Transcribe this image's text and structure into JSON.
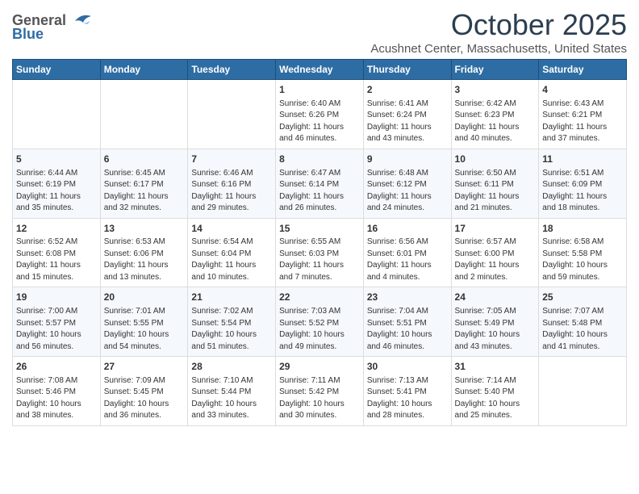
{
  "header": {
    "logo_general": "General",
    "logo_blue": "Blue",
    "month_title": "October 2025",
    "location": "Acushnet Center, Massachusetts, United States"
  },
  "weekdays": [
    "Sunday",
    "Monday",
    "Tuesday",
    "Wednesday",
    "Thursday",
    "Friday",
    "Saturday"
  ],
  "weeks": [
    [
      {
        "day": "",
        "info": ""
      },
      {
        "day": "",
        "info": ""
      },
      {
        "day": "",
        "info": ""
      },
      {
        "day": "1",
        "info": "Sunrise: 6:40 AM\nSunset: 6:26 PM\nDaylight: 11 hours\nand 46 minutes."
      },
      {
        "day": "2",
        "info": "Sunrise: 6:41 AM\nSunset: 6:24 PM\nDaylight: 11 hours\nand 43 minutes."
      },
      {
        "day": "3",
        "info": "Sunrise: 6:42 AM\nSunset: 6:23 PM\nDaylight: 11 hours\nand 40 minutes."
      },
      {
        "day": "4",
        "info": "Sunrise: 6:43 AM\nSunset: 6:21 PM\nDaylight: 11 hours\nand 37 minutes."
      }
    ],
    [
      {
        "day": "5",
        "info": "Sunrise: 6:44 AM\nSunset: 6:19 PM\nDaylight: 11 hours\nand 35 minutes."
      },
      {
        "day": "6",
        "info": "Sunrise: 6:45 AM\nSunset: 6:17 PM\nDaylight: 11 hours\nand 32 minutes."
      },
      {
        "day": "7",
        "info": "Sunrise: 6:46 AM\nSunset: 6:16 PM\nDaylight: 11 hours\nand 29 minutes."
      },
      {
        "day": "8",
        "info": "Sunrise: 6:47 AM\nSunset: 6:14 PM\nDaylight: 11 hours\nand 26 minutes."
      },
      {
        "day": "9",
        "info": "Sunrise: 6:48 AM\nSunset: 6:12 PM\nDaylight: 11 hours\nand 24 minutes."
      },
      {
        "day": "10",
        "info": "Sunrise: 6:50 AM\nSunset: 6:11 PM\nDaylight: 11 hours\nand 21 minutes."
      },
      {
        "day": "11",
        "info": "Sunrise: 6:51 AM\nSunset: 6:09 PM\nDaylight: 11 hours\nand 18 minutes."
      }
    ],
    [
      {
        "day": "12",
        "info": "Sunrise: 6:52 AM\nSunset: 6:08 PM\nDaylight: 11 hours\nand 15 minutes."
      },
      {
        "day": "13",
        "info": "Sunrise: 6:53 AM\nSunset: 6:06 PM\nDaylight: 11 hours\nand 13 minutes."
      },
      {
        "day": "14",
        "info": "Sunrise: 6:54 AM\nSunset: 6:04 PM\nDaylight: 11 hours\nand 10 minutes."
      },
      {
        "day": "15",
        "info": "Sunrise: 6:55 AM\nSunset: 6:03 PM\nDaylight: 11 hours\nand 7 minutes."
      },
      {
        "day": "16",
        "info": "Sunrise: 6:56 AM\nSunset: 6:01 PM\nDaylight: 11 hours\nand 4 minutes."
      },
      {
        "day": "17",
        "info": "Sunrise: 6:57 AM\nSunset: 6:00 PM\nDaylight: 11 hours\nand 2 minutes."
      },
      {
        "day": "18",
        "info": "Sunrise: 6:58 AM\nSunset: 5:58 PM\nDaylight: 10 hours\nand 59 minutes."
      }
    ],
    [
      {
        "day": "19",
        "info": "Sunrise: 7:00 AM\nSunset: 5:57 PM\nDaylight: 10 hours\nand 56 minutes."
      },
      {
        "day": "20",
        "info": "Sunrise: 7:01 AM\nSunset: 5:55 PM\nDaylight: 10 hours\nand 54 minutes."
      },
      {
        "day": "21",
        "info": "Sunrise: 7:02 AM\nSunset: 5:54 PM\nDaylight: 10 hours\nand 51 minutes."
      },
      {
        "day": "22",
        "info": "Sunrise: 7:03 AM\nSunset: 5:52 PM\nDaylight: 10 hours\nand 49 minutes."
      },
      {
        "day": "23",
        "info": "Sunrise: 7:04 AM\nSunset: 5:51 PM\nDaylight: 10 hours\nand 46 minutes."
      },
      {
        "day": "24",
        "info": "Sunrise: 7:05 AM\nSunset: 5:49 PM\nDaylight: 10 hours\nand 43 minutes."
      },
      {
        "day": "25",
        "info": "Sunrise: 7:07 AM\nSunset: 5:48 PM\nDaylight: 10 hours\nand 41 minutes."
      }
    ],
    [
      {
        "day": "26",
        "info": "Sunrise: 7:08 AM\nSunset: 5:46 PM\nDaylight: 10 hours\nand 38 minutes."
      },
      {
        "day": "27",
        "info": "Sunrise: 7:09 AM\nSunset: 5:45 PM\nDaylight: 10 hours\nand 36 minutes."
      },
      {
        "day": "28",
        "info": "Sunrise: 7:10 AM\nSunset: 5:44 PM\nDaylight: 10 hours\nand 33 minutes."
      },
      {
        "day": "29",
        "info": "Sunrise: 7:11 AM\nSunset: 5:42 PM\nDaylight: 10 hours\nand 30 minutes."
      },
      {
        "day": "30",
        "info": "Sunrise: 7:13 AM\nSunset: 5:41 PM\nDaylight: 10 hours\nand 28 minutes."
      },
      {
        "day": "31",
        "info": "Sunrise: 7:14 AM\nSunset: 5:40 PM\nDaylight: 10 hours\nand 25 minutes."
      },
      {
        "day": "",
        "info": ""
      }
    ]
  ]
}
